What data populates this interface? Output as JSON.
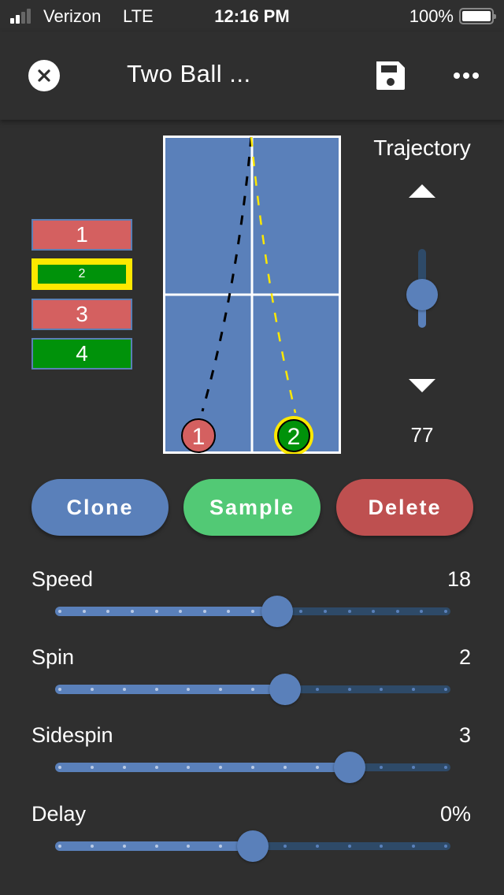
{
  "status_bar": {
    "carrier": "Verizon",
    "network": "LTE",
    "time": "12:16 PM",
    "battery_percent": "100%",
    "signal_bars_active": 2,
    "signal_bars_total": 4
  },
  "toolbar": {
    "close_icon": "close-circle-icon",
    "title": "Two Ball ...",
    "save_icon": "floppy-disk-icon",
    "more_icon": "ellipsis-icon"
  },
  "shots": [
    {
      "label": "1",
      "color": "#d46060",
      "selected": false
    },
    {
      "label": "2",
      "color": "#00920a",
      "selected": true
    },
    {
      "label": "3",
      "color": "#d46060",
      "selected": false
    },
    {
      "label": "4",
      "color": "#00920a",
      "selected": false
    }
  ],
  "table": {
    "color": "#5a80ba",
    "line_color": "#ffffff",
    "balls": [
      {
        "label": "1",
        "color": "#d46060",
        "trail_color": "#000000",
        "selected": false
      },
      {
        "label": "2",
        "color": "#00920a",
        "trail_color": "#fde800",
        "selected": true
      }
    ]
  },
  "trajectory": {
    "label": "Trajectory",
    "value": "77",
    "position_fraction": 0.42,
    "up_icon": "triangle-up-icon",
    "down_icon": "triangle-down-icon"
  },
  "actions": {
    "clone": "Clone",
    "sample": "Sample",
    "delete": "Delete"
  },
  "sliders": [
    {
      "label": "Speed",
      "value": "18",
      "steps": 16,
      "step_index": 9
    },
    {
      "label": "Spin",
      "value": "2",
      "steps": 12,
      "step_index": 7
    },
    {
      "label": "Sidespin",
      "value": "3",
      "steps": 12,
      "step_index": 9
    },
    {
      "label": "Delay",
      "value": "0%",
      "steps": 12,
      "step_index": 6
    }
  ],
  "colors": {
    "background": "#2f2f2f",
    "accent_blue": "#5a80ba",
    "track_dark": "#2e4a68",
    "green": "#52c975",
    "red": "#be5050",
    "highlight_yellow": "#fde800"
  }
}
